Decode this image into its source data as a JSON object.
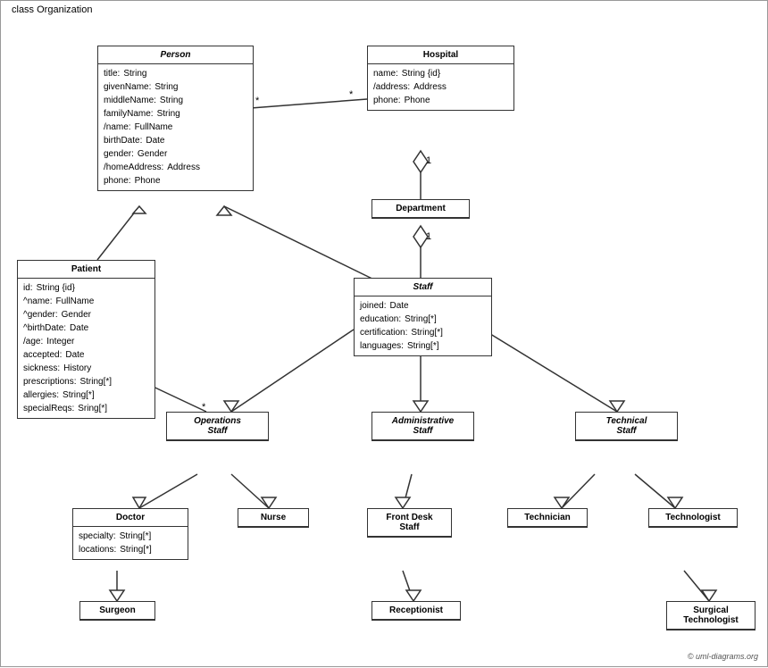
{
  "diagram": {
    "title": "class Organization",
    "classes": {
      "person": {
        "name": "Person",
        "italic": true,
        "attrs": [
          [
            "title:",
            "String"
          ],
          [
            "givenName:",
            "String"
          ],
          [
            "middleName:",
            "String"
          ],
          [
            "familyName:",
            "String"
          ],
          [
            "/name:",
            "FullName"
          ],
          [
            "birthDate:",
            "Date"
          ],
          [
            "gender:",
            "Gender"
          ],
          [
            "/homeAddress:",
            "Address"
          ],
          [
            "phone:",
            "Phone"
          ]
        ]
      },
      "hospital": {
        "name": "Hospital",
        "italic": false,
        "attrs": [
          [
            "name:",
            "String {id}"
          ],
          [
            "/address:",
            "Address"
          ],
          [
            "phone:",
            "Phone"
          ]
        ]
      },
      "department": {
        "name": "Department",
        "italic": false,
        "attrs": []
      },
      "staff": {
        "name": "Staff",
        "italic": true,
        "attrs": [
          [
            "joined:",
            "Date"
          ],
          [
            "education:",
            "String[*]"
          ],
          [
            "certification:",
            "String[*]"
          ],
          [
            "languages:",
            "String[*]"
          ]
        ]
      },
      "patient": {
        "name": "Patient",
        "italic": false,
        "attrs": [
          [
            "id:",
            "String {id}"
          ],
          [
            "^name:",
            "FullName"
          ],
          [
            "^gender:",
            "Gender"
          ],
          [
            "^birthDate:",
            "Date"
          ],
          [
            "/age:",
            "Integer"
          ],
          [
            "accepted:",
            "Date"
          ],
          [
            "sickness:",
            "History"
          ],
          [
            "prescriptions:",
            "String[*]"
          ],
          [
            "allergies:",
            "String[*]"
          ],
          [
            "specialReqs:",
            "Sring[*]"
          ]
        ]
      },
      "operations_staff": {
        "name": "Operations Staff",
        "italic": true,
        "attrs": []
      },
      "administrative_staff": {
        "name": "Administrative Staff",
        "italic": true,
        "attrs": []
      },
      "technical_staff": {
        "name": "Technical Staff",
        "italic": true,
        "attrs": []
      },
      "doctor": {
        "name": "Doctor",
        "italic": false,
        "attrs": [
          [
            "specialty:",
            "String[*]"
          ],
          [
            "locations:",
            "String[*]"
          ]
        ]
      },
      "nurse": {
        "name": "Nurse",
        "italic": false,
        "attrs": []
      },
      "front_desk_staff": {
        "name": "Front Desk Staff",
        "italic": false,
        "attrs": []
      },
      "technician": {
        "name": "Technician",
        "italic": false,
        "attrs": []
      },
      "technologist": {
        "name": "Technologist",
        "italic": false,
        "attrs": []
      },
      "surgeon": {
        "name": "Surgeon",
        "italic": false,
        "attrs": []
      },
      "receptionist": {
        "name": "Receptionist",
        "italic": false,
        "attrs": []
      },
      "surgical_technologist": {
        "name": "Surgical Technologist",
        "italic": false,
        "attrs": []
      }
    },
    "copyright": "© uml-diagrams.org"
  }
}
